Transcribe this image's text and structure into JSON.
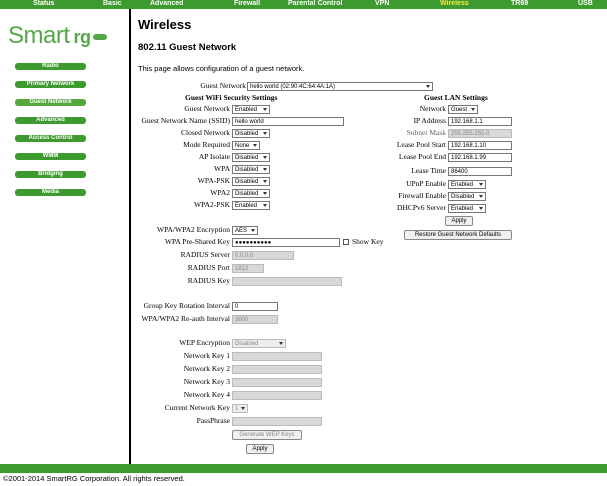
{
  "topnav": [
    "Status",
    "Basic",
    "Advanced",
    "Firewall",
    "Parental Control",
    "VPN",
    "Wireless",
    "TR69",
    "USB"
  ],
  "topnav_active": "Wireless",
  "logo": {
    "text": "Smart",
    "rg": "rg"
  },
  "sidenav": [
    "Radio",
    "Primary Network",
    "Guest Network",
    "Advanced",
    "Access Control",
    "WMM",
    "Bridging",
    "Media"
  ],
  "sidenav_active": "Guest Network",
  "page": {
    "title": "Wireless",
    "subtitle": "802.11 Guest Network",
    "description": "This page allows configuration of a guest network."
  },
  "guest_network": {
    "label": "Guest Network",
    "value": "hello world (02:90:4C:64:4A:1A)"
  },
  "wifi_security": {
    "heading": "Guest WiFi Security Settings",
    "guest_network_label": "Guest Network",
    "guest_network_value": "Enabled",
    "ssid_label": "Guest Network Name (SSID)",
    "ssid_value": "hello world",
    "closed_label": "Closed Network",
    "closed_value": "Disabled",
    "mode_label": "Mode Required",
    "mode_value": "None",
    "ap_label": "AP Isolate",
    "ap_value": "Disabled",
    "wpa_label": "WPA",
    "wpa_value": "Disabled",
    "wpapsk_label": "WPA-PSK",
    "wpapsk_value": "Disabled",
    "wpa2_label": "WPA2",
    "wpa2_value": "Disabled",
    "wpa2psk_label": "WPA2-PSK",
    "wpa2psk_value": "Enabled",
    "enc_label": "WPA/WPA2 Encryption",
    "enc_value": "AES",
    "psk_label": "WPA Pre-Shared Key",
    "psk_value": "●●●●●●●●●●",
    "showkey_label": "Show Key",
    "radius_server_label": "RADIUS Server",
    "radius_server_value": "0.0.0.0",
    "radius_port_label": "RADIUS Port",
    "radius_port_value": "1812",
    "radius_key_label": "RADIUS Key",
    "radius_key_value": "",
    "gkri_label": "Group Key Rotation Interval",
    "gkri_value": "0",
    "reauth_label": "WPA/WPA2 Re-auth Interval",
    "reauth_value": "3600",
    "wep_label": "WEP Encryption",
    "wep_value": "Disabled",
    "nk1_label": "Network Key 1",
    "nk2_label": "Network Key 2",
    "nk3_label": "Network Key 3",
    "nk4_label": "Network Key 4",
    "cnk_label": "Current Network Key",
    "cnk_value": "1",
    "pass_label": "PassPhrase",
    "genwep_label": "Generate WEP Keys",
    "apply_label": "Apply"
  },
  "lan": {
    "heading": "Guest LAN Settings",
    "network_label": "Network",
    "network_value": "Guest",
    "ip_label": "IP Address",
    "ip_value": "192.168.1.1",
    "mask_label": "Subnet Mask",
    "mask_value": "255.255.255.0",
    "start_label": "Lease Pool Start",
    "start_value": "192.168.1.10",
    "end_label": "Lease Pool End",
    "end_value": "192.168.1.99",
    "time_label": "Lease Time",
    "time_value": "86400",
    "upnp_label": "UPnP Enable",
    "upnp_value": "Enabled",
    "fw_label": "Firewall Enable",
    "fw_value": "Disabled",
    "dhcp_label": "DHCPv6 Server",
    "dhcp_value": "Enabled",
    "apply_label": "Apply",
    "restore_label": "Restore Guest Network Defaults"
  },
  "footer": "©2001-2014 SmartRG Corporation. All rights reserved."
}
